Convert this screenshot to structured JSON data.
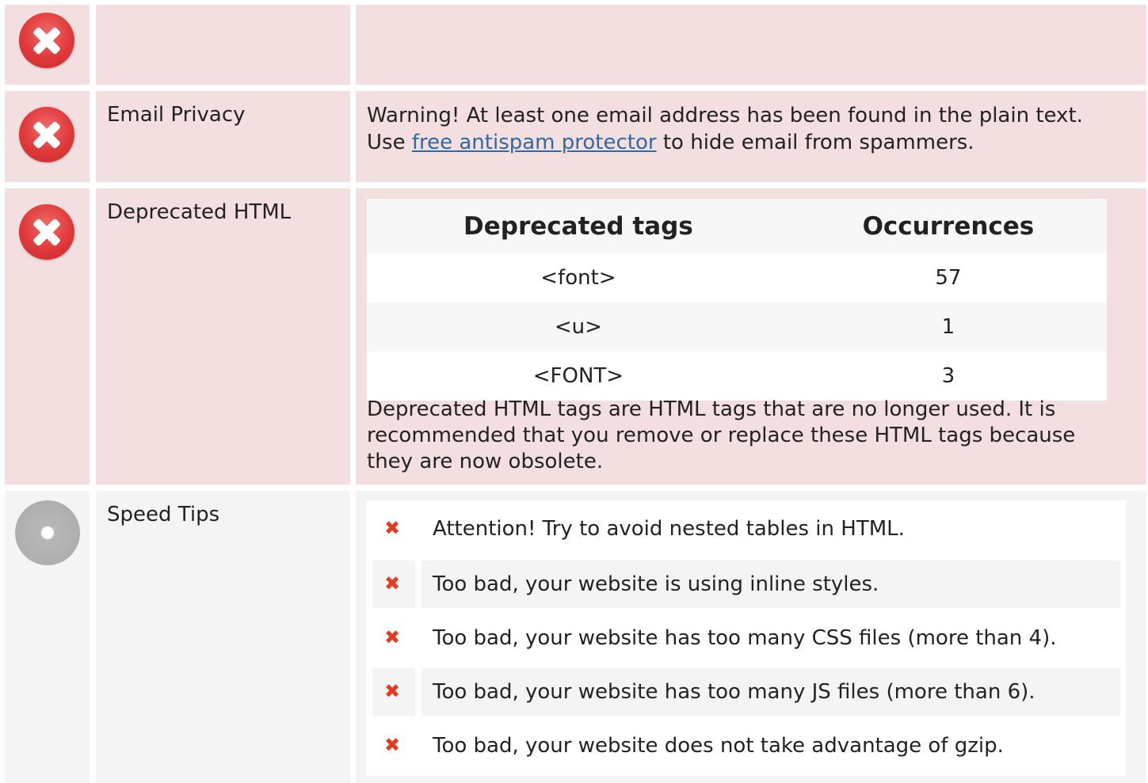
{
  "rows": [
    {
      "status": "error",
      "label": "",
      "body": ""
    },
    {
      "status": "error",
      "label": "Email Privacy",
      "warning_prefix": "Warning! At least one email address has been found in the plain text. Use ",
      "link_text": "free antispam protector",
      "warning_suffix": " to hide email from spammers."
    }
  ],
  "deprecated": {
    "status": "error",
    "label": "Deprecated HTML",
    "columns": [
      "Deprecated tags",
      "Occurrences"
    ],
    "tags": [
      {
        "tag": "<font>",
        "count": "57"
      },
      {
        "tag": "<u>",
        "count": "1"
      },
      {
        "tag": "<FONT>",
        "count": "3"
      }
    ],
    "note": "Deprecated HTML tags are HTML tags that are no longer used. It is recommended that you remove or replace these HTML tags because they are now obsolete."
  },
  "speed": {
    "status": "neutral",
    "label": "Speed Tips",
    "mark_glyph": "✖",
    "tips": [
      "Attention! Try to avoid nested tables in HTML.",
      "Too bad, your website is using inline styles.",
      "Too bad, your website has too many CSS files (more than 4).",
      "Too bad, your website has too many JS files (more than 6).",
      "Too bad, your website does not take advantage of gzip."
    ]
  },
  "colors": {
    "error_bg": "#f3dee0",
    "neutral_bg": "#f4f4f4",
    "error_icon": "#e0393a",
    "link": "#2d6aa6",
    "x_mark": "#e63b1e"
  }
}
